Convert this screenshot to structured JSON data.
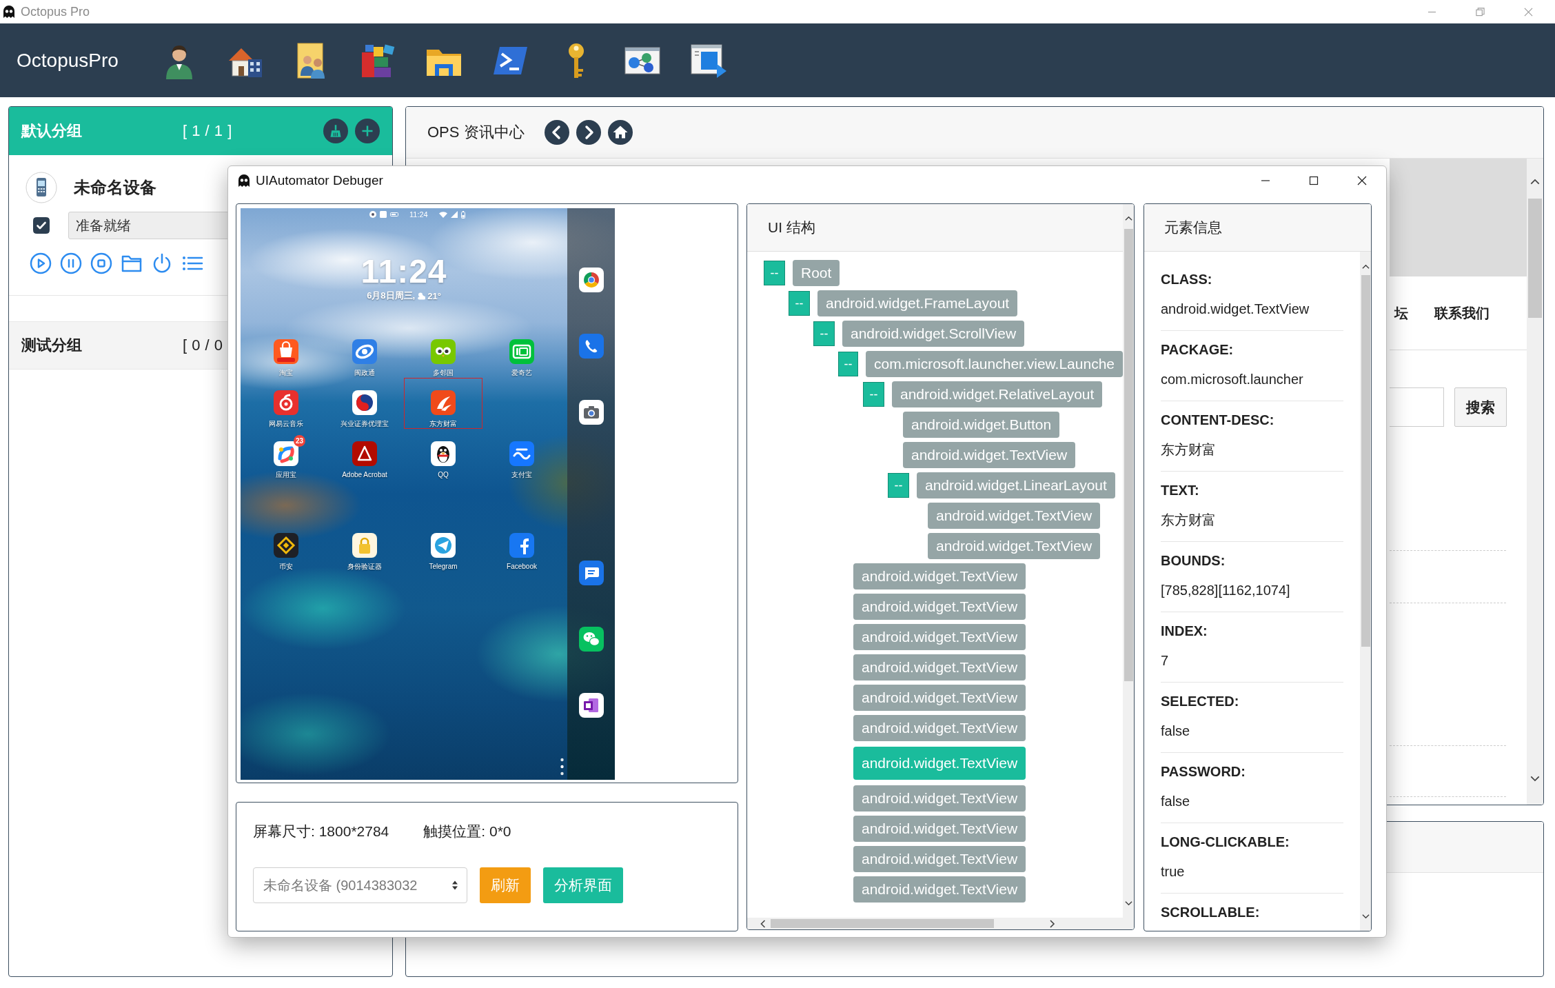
{
  "window": {
    "title": "Octopus Pro"
  },
  "header": {
    "brand": "OctopusPro"
  },
  "groups": [
    {
      "name": "默认分组",
      "count": "[ 1 / 1 ]",
      "selected": true,
      "devices": [
        {
          "name": "未命名设备",
          "checked": true,
          "status": "准备就绪"
        }
      ]
    },
    {
      "name": "测试分组",
      "count": "[ 0 / 0",
      "selected": false
    }
  ],
  "ops_panel": {
    "title": "OPS 资讯中心",
    "nav_links": [
      "坛",
      "联系我们"
    ],
    "search_button": "搜索"
  },
  "debugger": {
    "title": "UIAutomator Debuger",
    "phone": {
      "status_time": "11:24",
      "clock": "11:24",
      "date": "6月8日周三,",
      "temperature": "21°",
      "app_rows": [
        [
          {
            "label": "淘宝",
            "selected": false
          },
          {
            "label": "闽政通",
            "selected": false
          },
          {
            "label": "多邻国",
            "selected": false
          },
          {
            "label": "爱奇艺",
            "selected": false
          }
        ],
        [
          {
            "label": "网易云音乐",
            "selected": false
          },
          {
            "label": "兴业证券优理宝",
            "selected": false
          },
          {
            "label": "东方财富",
            "selected": true
          }
        ],
        [
          {
            "label": "应用宝",
            "badge": "23",
            "selected": false
          },
          {
            "label": "Adobe Acrobat",
            "selected": false
          },
          {
            "label": "QQ",
            "selected": false
          },
          {
            "label": "支付宝",
            "selected": false
          }
        ],
        [
          {
            "label": "币安",
            "selected": false
          },
          {
            "label": "身份验证器",
            "selected": false
          },
          {
            "label": "Telegram",
            "selected": false
          },
          {
            "label": "Facebook",
            "selected": false
          }
        ]
      ]
    },
    "screen_size": "屏幕尺寸: 1800*2784",
    "touch_position": "触摸位置: 0*0",
    "device_select": "未命名设备 (9014383032",
    "buttons": [
      {
        "label": "刷新",
        "kind": "refresh"
      },
      {
        "label": "分析界面",
        "kind": "analyze"
      }
    ],
    "tree": {
      "title": "UI 结构",
      "nodes": [
        {
          "label": "Root",
          "toggle": "--",
          "expanded": true,
          "selected": false,
          "children": [
            {
              "label": "android.widget.FrameLayout",
              "toggle": "--",
              "expanded": true,
              "selected": false,
              "children": [
                {
                  "label": "android.widget.ScrollView",
                  "toggle": "--",
                  "expanded": true,
                  "selected": false,
                  "children": [
                    {
                      "label": "com.microsoft.launcher.view.Launche",
                      "toggle": "--",
                      "expanded": true,
                      "selected": false,
                      "children": [
                        {
                          "label": "android.widget.RelativeLayout",
                          "toggle": "--",
                          "expanded": true,
                          "selected": false,
                          "children": [
                            {
                              "label": "android.widget.Button",
                              "selected": false
                            },
                            {
                              "label": "android.widget.TextView",
                              "selected": false
                            },
                            {
                              "label": "android.widget.LinearLayout",
                              "toggle": "--",
                              "expanded": true,
                              "selected": false,
                              "children": [
                                {
                                  "label": "android.widget.TextView",
                                  "selected": false
                                },
                                {
                                  "label": "android.widget.TextView",
                                  "selected": false
                                }
                              ]
                            }
                          ]
                        }
                      ]
                    },
                    {
                      "label": "android.widget.TextView",
                      "selected": false
                    },
                    {
                      "label": "android.widget.TextView",
                      "selected": false
                    },
                    {
                      "label": "android.widget.TextView",
                      "selected": false
                    },
                    {
                      "label": "android.widget.TextView",
                      "selected": false
                    },
                    {
                      "label": "android.widget.TextView",
                      "selected": false
                    },
                    {
                      "label": "android.widget.TextView",
                      "selected": false
                    },
                    {
                      "label": "android.widget.TextView",
                      "selected": true
                    },
                    {
                      "label": "android.widget.TextView",
                      "selected": false
                    },
                    {
                      "label": "android.widget.TextView",
                      "selected": false
                    },
                    {
                      "label": "android.widget.TextView",
                      "selected": false
                    },
                    {
                      "label": "android.widget.TextView",
                      "selected": false
                    }
                  ]
                }
              ]
            }
          ]
        }
      ]
    },
    "element_info": {
      "title": "元素信息",
      "fields": [
        {
          "label": "CLASS:",
          "value": "android.widget.TextView"
        },
        {
          "label": "PACKAGE:",
          "value": "com.microsoft.launcher"
        },
        {
          "label": "CONTENT-DESC:",
          "value": "东方财富"
        },
        {
          "label": "TEXT:",
          "value": "东方财富"
        },
        {
          "label": "BOUNDS:",
          "value": "[785,828][1162,1074]"
        },
        {
          "label": "INDEX:",
          "value": "7"
        },
        {
          "label": "SELECTED:",
          "value": "false"
        },
        {
          "label": "PASSWORD:",
          "value": "false"
        },
        {
          "label": "LONG-CLICKABLE:",
          "value": "true"
        },
        {
          "label": "SCROLLABLE:"
        }
      ]
    }
  }
}
